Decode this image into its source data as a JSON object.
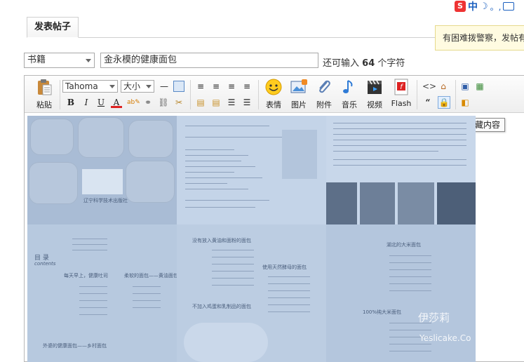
{
  "ime": {
    "logo": "S",
    "mode": "中",
    "punct": "。,"
  },
  "tab": {
    "label": "发表帖子"
  },
  "hint": {
    "text": "有困难拨警察，发帖有"
  },
  "category": {
    "selected": "书籍"
  },
  "subject": {
    "value": "金永模的健康面包"
  },
  "remaining": {
    "prefix": "还可输入",
    "count": "64",
    "suffix": "个字符"
  },
  "toolbar": {
    "paste": "粘贴",
    "font": "Tahoma",
    "size": "大小",
    "emoji": "表情",
    "image": "图片",
    "attach": "附件",
    "music": "音乐",
    "video": "视频",
    "flash": "Flash",
    "bold": "B",
    "italic": "I",
    "underline": "U",
    "fontcolor": "A",
    "quote": "“"
  },
  "tooltip": {
    "text": "添加隐藏内容"
  },
  "content": {
    "publisher": "辽宁科学技术出版社",
    "toc_title": "目 录",
    "toc_sub": "contents",
    "sec1": "没有放入黄油和面粉的面包",
    "sec2": "使用天然酵母的面包",
    "sec3": "湖北的大米面包",
    "sec4": "不加入鸡蛋和乳制品的面包",
    "sec5": "100%纯大米面包",
    "sec6": "每天早上，健康吐司",
    "sec7": "柔软的面包——黄油面包卷",
    "sec8": "外婆的健康面包——乡村面包",
    "wm1": "伊莎莉",
    "wm2": "Yeslicake.Co"
  },
  "colors": {
    "accent": "#1a5fbf",
    "hint_bg": "#fffbe1",
    "content_tint": "#c7d7ea"
  }
}
